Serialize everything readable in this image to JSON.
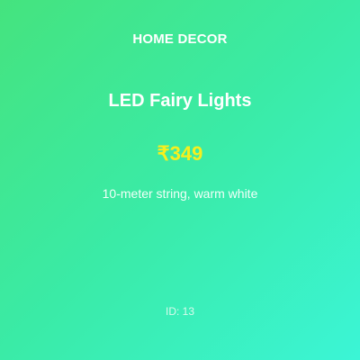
{
  "product": {
    "category": "HOME DECOR",
    "title": "LED Fairy Lights",
    "price": "₹349",
    "description": "10-meter string, warm white",
    "id_text": "ID: 13"
  },
  "colors": {
    "gradient_start": "#45e37e",
    "gradient_end": "#3bf5d6",
    "price_color": "#f7ef1d",
    "text_color": "#ffffff"
  }
}
